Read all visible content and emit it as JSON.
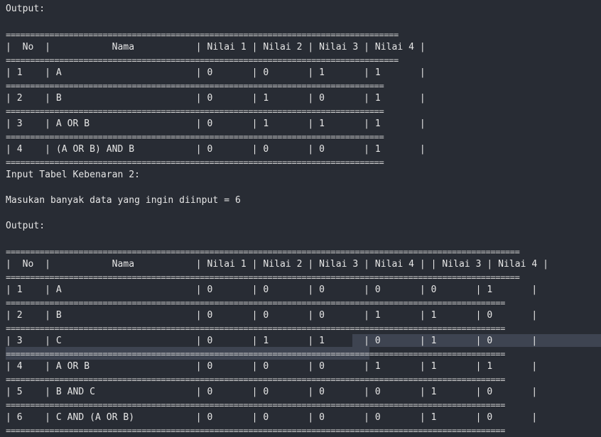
{
  "terminal": {
    "lines": [
      "Output:",
      "",
      "=================================================================================",
      "|  No  |           Nama           | Nilai 1 | Nilai 2 | Nilai 3 | Nilai 4 |",
      "=================================================================================",
      "| 1    | A                        | 0       | 0       | 1       | 1       |",
      "==============================================================================",
      "| 2    | B                        | 0       | 1       | 0       | 1       |",
      "==============================================================================",
      "| 3    | A OR B                   | 0       | 1       | 1       | 1       |",
      "==============================================================================",
      "| 4    | (A OR B) AND B           | 0       | 0       | 0       | 1       |",
      "==============================================================================",
      "Input Tabel Kebenaran 2:",
      "",
      "Masukan banyak data yang ingin diinput = 6",
      "",
      "Output:",
      "",
      "==========================================================================================================",
      "|  No  |           Nama           | Nilai 1 | Nilai 2 | Nilai 3 | Nilai 4 | | Nilai 3 | Nilai 4 |",
      "==========================================================================================================",
      "| 1    | A                        | 0       | 0       | 0       | 0       | 0       | 1       |",
      "=======================================================================================================",
      "| 2    | B                        | 0       | 0       | 0       | 1       | 1       | 0       |",
      "=======================================================================================================",
      "| 3    | C                        | 0       | 1       | 1       | 0       | 1       | 0       |",
      "=======================================================================================================",
      "| 4    | A OR B                   | 0       | 0       | 0       | 1       | 1       | 1       |",
      "=======================================================================================================",
      "| 5    | B AND C                  | 0       | 0       | 0       | 0       | 1       | 0       |",
      "=======================================================================================================",
      "| 6    | C AND (A OR B)           | 0       | 0       | 0       | 0       | 1       | 0       |",
      "======================================================================================================="
    ]
  }
}
